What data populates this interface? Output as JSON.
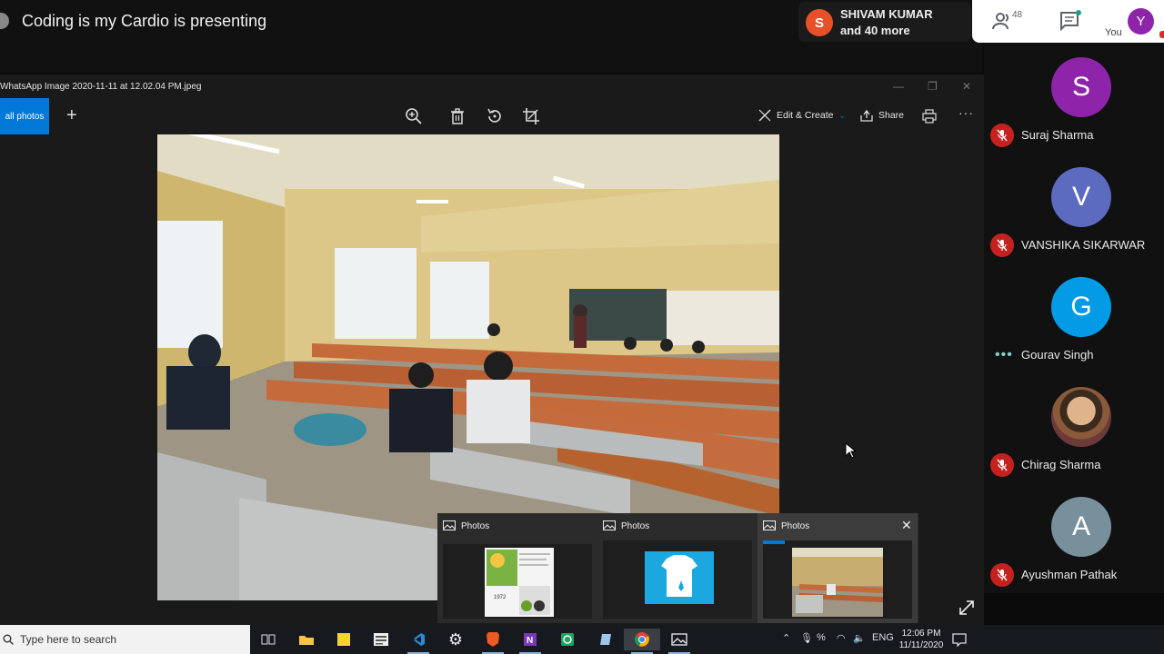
{
  "meet": {
    "presenting_title": "Coding is my Cardio is presenting",
    "speaker": {
      "initial": "S",
      "name": "SHIVAM KUMAR",
      "more": "and 40 more",
      "color": "#e8502a"
    },
    "participant_count": "48",
    "you_initial": "Y",
    "you_label": "You",
    "participants": [
      {
        "name": "Suraj Sharma",
        "initial": "S",
        "color": "#8e24aa",
        "muted": true
      },
      {
        "name": "VANSHIKA SIKARWAR",
        "initial": "V",
        "color": "#5c6bc0",
        "muted": true
      },
      {
        "name": "Gourav Singh",
        "initial": "G",
        "color": "#039be5",
        "muted": false
      },
      {
        "name": "Chirag Sharma",
        "initial": "",
        "color": "#6d3a3a",
        "muted": true,
        "photo": true
      },
      {
        "name": "Ayushman Pathak",
        "initial": "A",
        "color": "#78909c",
        "muted": true
      }
    ]
  },
  "photos": {
    "file_title": "WhatsApp Image 2020-11-11 at 12.02.04 PM.jpeg",
    "all_photos_label": "all photos",
    "add_label": "+",
    "edit_create_label": "Edit & Create",
    "share_label": "Share",
    "more_label": "···"
  },
  "previews": [
    {
      "title": "Photos"
    },
    {
      "title": "Photos"
    },
    {
      "title": "Photos",
      "close": "✕"
    }
  ],
  "preview_thumb_year": "1972",
  "taskbar": {
    "search_placeholder": "Type here to search",
    "lang": "ENG",
    "time": "12:06 PM",
    "date": "11/11/2020"
  }
}
